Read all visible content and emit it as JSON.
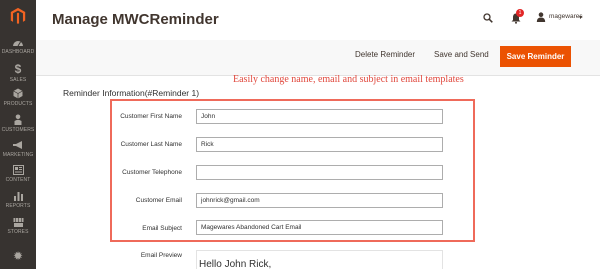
{
  "sidebar": {
    "items": [
      {
        "label": "DASHBOARD",
        "icon": "dashboard-icon"
      },
      {
        "label": "SALES",
        "icon": "dollar-icon"
      },
      {
        "label": "PRODUCTS",
        "icon": "cube-icon"
      },
      {
        "label": "CUSTOMERS",
        "icon": "person-icon"
      },
      {
        "label": "MARKETING",
        "icon": "megaphone-icon"
      },
      {
        "label": "CONTENT",
        "icon": "content-icon"
      },
      {
        "label": "REPORTS",
        "icon": "bar-chart-icon"
      },
      {
        "label": "STORES",
        "icon": "store-icon"
      },
      {
        "label": "",
        "icon": "gear-icon"
      }
    ]
  },
  "header": {
    "title": "Manage MWCReminder",
    "notification_count": "1",
    "user_name": "magewares"
  },
  "actions": {
    "delete_label": "Delete Reminder",
    "save_send_label": "Save and Send",
    "save_label": "Save Reminder"
  },
  "section": {
    "title": "Reminder Information(#Reminder 1)"
  },
  "annotation": {
    "text": "Easily change name, email and subject in email templates"
  },
  "form": {
    "first_name_label": "Customer First Name",
    "first_name_value": "John",
    "last_name_label": "Customer Last Name",
    "last_name_value": "Rick",
    "telephone_label": "Customer Telephone",
    "telephone_value": "",
    "email_label": "Customer Email",
    "email_value": "johnrick@gmail.com",
    "subject_label": "Email Subject",
    "subject_value": "Magewares Abandoned Cart Email",
    "preview_label": "Email Preview",
    "preview_text": "Hello John Rick,"
  },
  "colors": {
    "sidebar_bg": "#373330",
    "accent": "#eb5202",
    "annotation": "#e0483d",
    "badge": "#e22626"
  }
}
